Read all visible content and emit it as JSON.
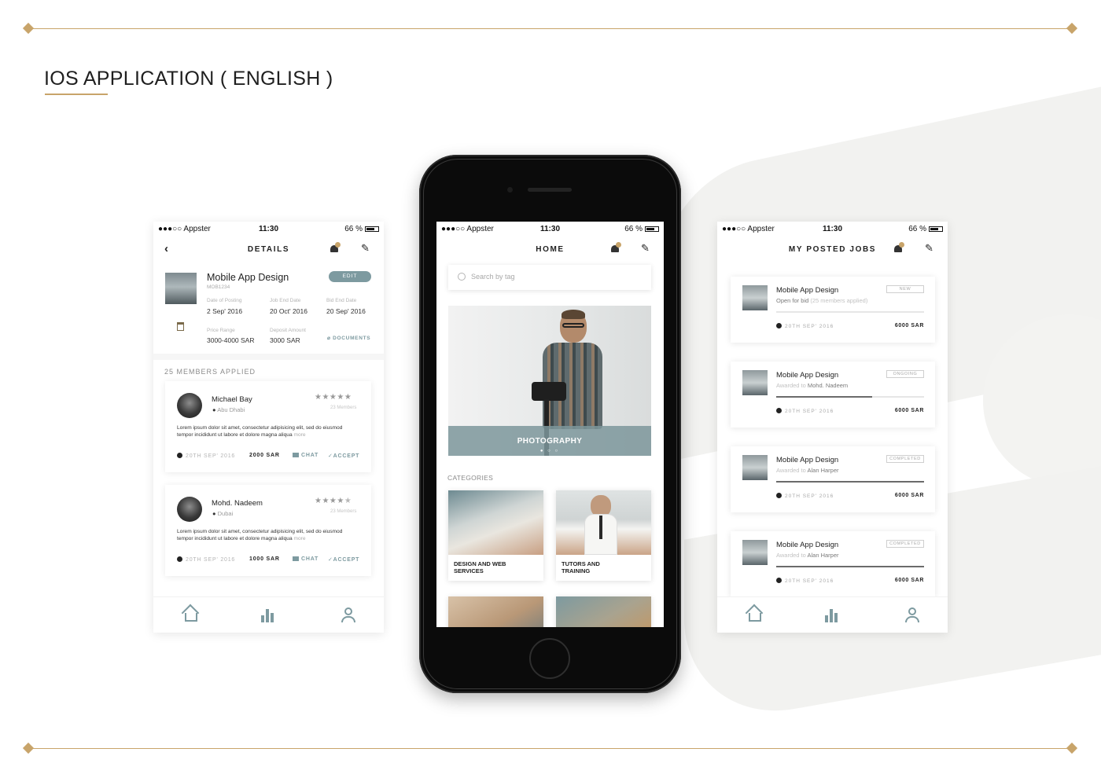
{
  "page": {
    "title": "IOS APPLICATION ( ENGLISH )",
    "accent": "#c8a46a",
    "primary": "#7d9aa0"
  },
  "status_bar": {
    "carrier": "●●●○○ Appster",
    "time": "11:30",
    "battery": "66 %"
  },
  "details": {
    "nav_title": "DETAILS",
    "back_icon": "chevron-left-icon",
    "job": {
      "title": "Mobile App Design",
      "code": "MOB1234",
      "edit_label": "EDIT",
      "date_posting_label": "Date of Posting",
      "date_posting": "2 Sep' 2016",
      "job_end_label": "Job End Date",
      "job_end": "20 Oct' 2016",
      "bid_end_label": "Bid End Date",
      "bid_end": "20 Sep' 2016",
      "price_range_label": "Price Range",
      "price_range": "3000-4000 SAR",
      "deposit_label": "Deposit Amount",
      "deposit": "3000 SAR",
      "documents_label": "DOCUMENTS"
    },
    "members_heading": "25 MEMBERS APPLIED",
    "members": [
      {
        "name": "Michael Bay",
        "location": "Abu Dhabi",
        "rating": 5,
        "members": "23 Members",
        "text": "Lorem ipsum dolor sit amet, consectetur adipisicing elit, sed do eiusmod tempor incididunt ut labore et dolore magna aliqua",
        "more": "more",
        "date": "20TH SEP' 2016",
        "price": "2000 SAR",
        "chat": "CHAT",
        "accept": "ACCEPT"
      },
      {
        "name": "Mohd. Nadeem",
        "location": "Dubai",
        "rating": 4,
        "members": "23 Members",
        "text": "Lorem ipsum dolor sit amet, consectetur adipisicing elit, sed do eiusmod tempor incididunt ut labore et dolore magna aliqua",
        "more": "more",
        "date": "20TH SEP' 2016",
        "price": "1000 SAR",
        "chat": "CHAT",
        "accept": "ACCEPT"
      }
    ]
  },
  "home": {
    "nav_title": "HOME",
    "search_placeholder": "Search by tag",
    "hero_label": "PHOTOGRAPHY",
    "categories_heading": "CATEGORIES",
    "categories": [
      {
        "line1": "DESIGN AND WEB",
        "line2": "SERVICES"
      },
      {
        "line1": "TUTORS AND",
        "line2": "TRAINING"
      }
    ]
  },
  "posted_jobs": {
    "nav_title": "MY POSTED JOBS",
    "jobs": [
      {
        "title": "Mobile App Design",
        "sub_prefix": "Open for bid",
        "sub_suffix": " (25 members applied)",
        "badge": "NEW",
        "date": "20TH SEP' 2016",
        "price": "6000 SAR",
        "progress": 1.0
      },
      {
        "title": "Mobile App Design",
        "sub_prefix": "Awarded to ",
        "sub_suffix": "Mohd. Nadeem",
        "badge": "ONGOING",
        "date": "20TH SEP' 2016",
        "price": "6000 SAR",
        "progress": 0.65
      },
      {
        "title": "Mobile App Design",
        "sub_prefix": "Awarded to ",
        "sub_suffix": "Alan Harper",
        "badge": "COMPLETED",
        "date": "20TH SEP' 2016",
        "price": "6000 SAR",
        "progress": 1.0
      },
      {
        "title": "Mobile App Design",
        "sub_prefix": "Awarded to ",
        "sub_suffix": "Alan Harper",
        "badge": "COMPLETED",
        "date": "20TH SEP' 2016",
        "price": "6000 SAR",
        "progress": 1.0
      }
    ]
  },
  "tabbar": {
    "items": [
      "home-icon",
      "chart-icon",
      "user-icon"
    ]
  }
}
